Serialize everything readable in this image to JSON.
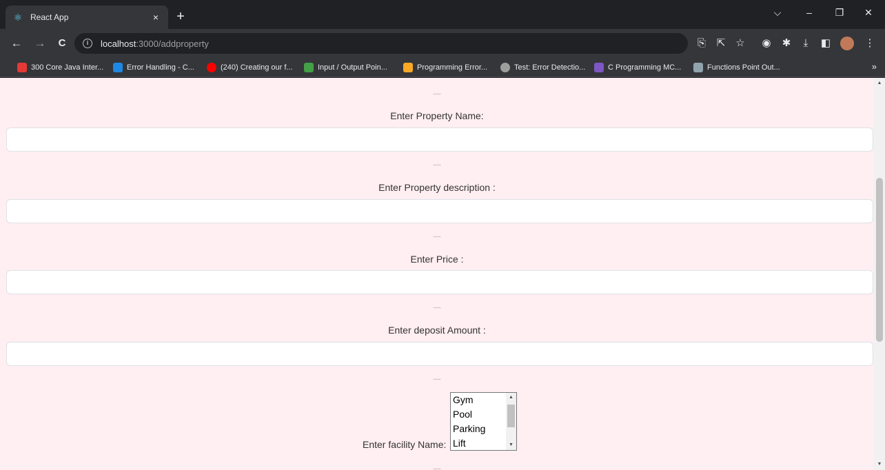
{
  "tab": {
    "title": "React App",
    "favicon": "react-icon",
    "close": "×"
  },
  "window": {
    "new_tab": "+",
    "dropdown": "⌵",
    "minimize": "–",
    "restore": "❐",
    "close": "✕"
  },
  "toolbar": {
    "back": "←",
    "forward": "→",
    "reload": "C",
    "url_host": "localhost",
    "url_rest": ":3000/addproperty",
    "menu": "⋮"
  },
  "bookmarks": [
    {
      "label": "300 Core Java Inter...",
      "icon_color": "#e53935"
    },
    {
      "label": "Error Handling - C...",
      "icon_color": "#1e88e5"
    },
    {
      "label": "(240) Creating our f...",
      "icon_color": "#ff0000"
    },
    {
      "label": "Input / Output Poin...",
      "icon_color": "#43a047"
    },
    {
      "label": "Programming Error...",
      "icon_color": "#f9a825"
    },
    {
      "label": "Test: Error Detectio...",
      "icon_color": "#9e9e9e"
    },
    {
      "label": "C Programming MC...",
      "icon_color": "#7e57c2"
    },
    {
      "label": "Functions Point Out...",
      "icon_color": "#90a4ae"
    }
  ],
  "bookmarks_more": "»",
  "form": {
    "separator": "....",
    "property_name_label": "Enter Property Name:",
    "property_description_label": "Enter Property description :",
    "price_label": "Enter Price :",
    "deposit_label": "Enter deposit Amount :",
    "facility_label": "Enter facility Name:",
    "facility_options": [
      "Gym",
      "Pool",
      "Parking",
      "Lift"
    ]
  },
  "colors": {
    "page_background": "#ffeef2",
    "browser_dark": "#202124",
    "browser_toolbar": "#35363a"
  }
}
